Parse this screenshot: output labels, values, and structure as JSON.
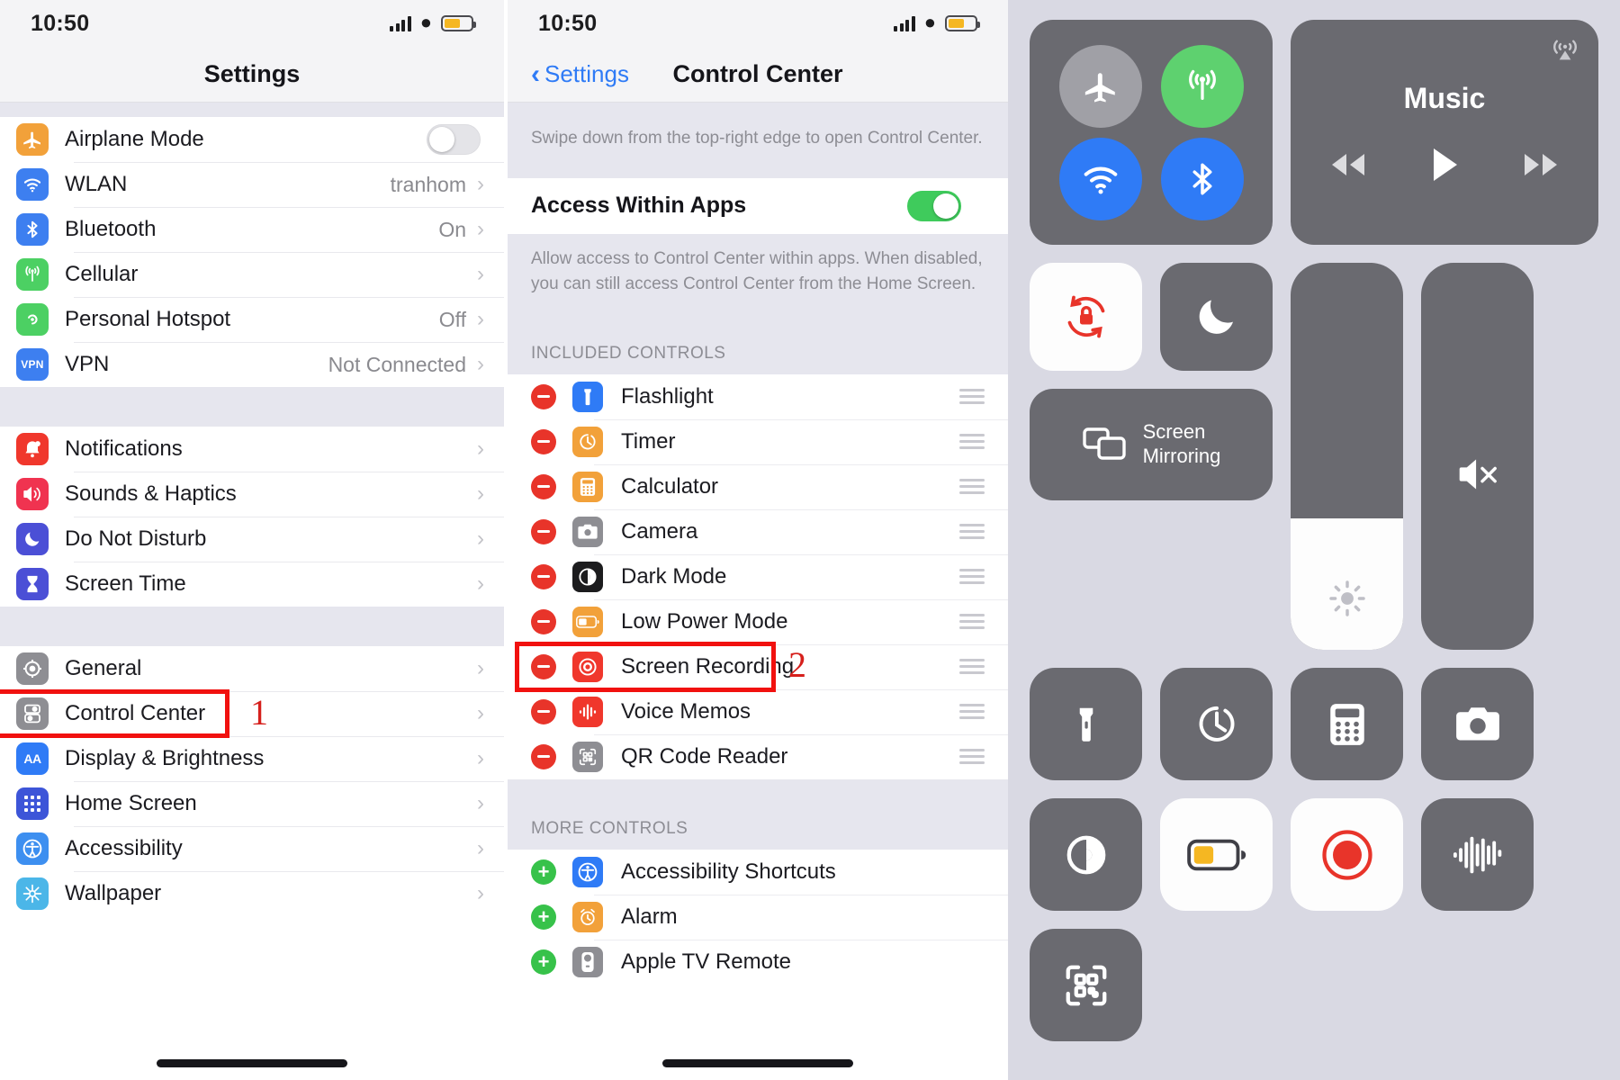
{
  "status_bar": {
    "time": "10:50",
    "battery_level_pct": 62
  },
  "panel_settings": {
    "nav_title": "Settings",
    "groups": [
      {
        "rows": [
          {
            "label": "Airplane Mode",
            "icon": "airplane-icon",
            "icon_bg": "#f2a13a",
            "accessory": "toggle",
            "toggle_on": false
          },
          {
            "label": "WLAN",
            "icon": "wifi-icon",
            "icon_bg": "#3d7ff0",
            "value": "tranhom",
            "accessory": "chevron"
          },
          {
            "label": "Bluetooth",
            "icon": "bluetooth-icon",
            "icon_bg": "#3d7ff0",
            "value": "On",
            "accessory": "chevron"
          },
          {
            "label": "Cellular",
            "icon": "cellular-icon",
            "icon_bg": "#4cd063",
            "value": "",
            "accessory": "chevron"
          },
          {
            "label": "Personal Hotspot",
            "icon": "hotspot-icon",
            "icon_bg": "#4cd063",
            "value": "Off",
            "accessory": "chevron"
          },
          {
            "label": "VPN",
            "icon": "vpn-icon",
            "icon_bg": "#3d7ff0",
            "value": "Not Connected",
            "accessory": "chevron"
          }
        ]
      },
      {
        "rows": [
          {
            "label": "Notifications",
            "icon": "notifications-icon",
            "icon_bg": "#f0372c",
            "value": "",
            "accessory": "chevron"
          },
          {
            "label": "Sounds & Haptics",
            "icon": "sounds-icon",
            "icon_bg": "#f03350",
            "value": "",
            "accessory": "chevron"
          },
          {
            "label": "Do Not Disturb",
            "icon": "moon-icon",
            "icon_bg": "#4b4fd6",
            "value": "",
            "accessory": "chevron"
          },
          {
            "label": "Screen Time",
            "icon": "hourglass-icon",
            "icon_bg": "#4b4fd6",
            "value": "",
            "accessory": "chevron"
          }
        ]
      },
      {
        "rows": [
          {
            "label": "General",
            "icon": "gear-icon",
            "icon_bg": "#8e8e93",
            "value": "",
            "accessory": "chevron"
          },
          {
            "label": "Control Center",
            "icon": "control-center-icon",
            "icon_bg": "#8e8e93",
            "value": "",
            "accessory": "chevron"
          },
          {
            "label": "Display & Brightness",
            "icon": "display-brightness-icon",
            "icon_bg": "#2f7bf6",
            "value": "",
            "accessory": "chevron"
          },
          {
            "label": "Home Screen",
            "icon": "home-screen-icon",
            "icon_bg": "#3d55d8",
            "value": "",
            "accessory": "chevron"
          },
          {
            "label": "Accessibility",
            "icon": "accessibility-icon",
            "icon_bg": "#3d8ff0",
            "value": "",
            "accessory": "chevron"
          },
          {
            "label": "Wallpaper",
            "icon": "wallpaper-icon",
            "icon_bg": "#4bb6e8",
            "value": "",
            "accessory": "chevron"
          }
        ]
      }
    ],
    "marker_label": "1",
    "highlight_target": "Control Center"
  },
  "panel_cc_settings": {
    "nav_back_label": "Settings",
    "nav_title": "Control Center",
    "hint_text": "Swipe down from the top-right edge to open Control Center.",
    "access_within_apps": {
      "label": "Access Within Apps",
      "enabled": true
    },
    "access_description": "Allow access to Control Center within apps. When disabled, you can still access Control Center from the Home Screen.",
    "included_header": "INCLUDED CONTROLS",
    "included_controls": [
      {
        "label": "Flashlight",
        "icon": "flashlight-icon",
        "icon_bg": "#2f7bf6",
        "action": "remove"
      },
      {
        "label": "Timer",
        "icon": "timer-icon",
        "icon_bg": "#f2a13a",
        "action": "remove"
      },
      {
        "label": "Calculator",
        "icon": "calculator-icon",
        "icon_bg": "#f2a13a",
        "action": "remove"
      },
      {
        "label": "Camera",
        "icon": "camera-icon",
        "icon_bg": "#8e8e93",
        "action": "remove"
      },
      {
        "label": "Dark Mode",
        "icon": "dark-mode-icon",
        "icon_bg": "#1c1c1e",
        "action": "remove"
      },
      {
        "label": "Low Power Mode",
        "icon": "low-power-mode-icon",
        "icon_bg": "#f2a13a",
        "action": "remove"
      },
      {
        "label": "Screen Recording",
        "icon": "screen-recording-icon",
        "icon_bg": "#f0372c",
        "action": "remove"
      },
      {
        "label": "Voice Memos",
        "icon": "voice-memos-icon",
        "icon_bg": "#f0372c",
        "action": "remove"
      },
      {
        "label": "QR Code Reader",
        "icon": "qr-code-icon",
        "icon_bg": "#8e8e93",
        "action": "remove"
      }
    ],
    "more_header": "MORE CONTROLS",
    "more_controls": [
      {
        "label": "Accessibility Shortcuts",
        "icon": "accessibility-icon",
        "icon_bg": "#2f7bf6",
        "action": "add"
      },
      {
        "label": "Alarm",
        "icon": "alarm-icon",
        "icon_bg": "#f2a13a",
        "action": "add"
      },
      {
        "label": "Apple TV Remote",
        "icon": "apple-tv-remote-icon",
        "icon_bg": "#8e8e93",
        "action": "add"
      }
    ],
    "marker_label": "2",
    "highlight_target": "Screen Recording"
  },
  "panel_control_center": {
    "connectivity": [
      {
        "name": "airplane-mode",
        "icon": "airplane-icon",
        "active": false,
        "color": "#a0a0a6"
      },
      {
        "name": "cellular-data",
        "icon": "cellular-icon",
        "active": true,
        "color": "#5ed16f"
      },
      {
        "name": "wifi",
        "icon": "wifi-icon",
        "active": true,
        "color": "#2f7bf6"
      },
      {
        "name": "bluetooth",
        "icon": "bluetooth-icon",
        "active": true,
        "color": "#2f7bf6"
      }
    ],
    "music": {
      "title": "Music",
      "prev_label": "rewind",
      "play_label": "play",
      "next_label": "fast-forward"
    },
    "rotation_lock": {
      "name": "rotation-lock",
      "active": true
    },
    "do_not_disturb": {
      "name": "do-not-disturb",
      "active": false
    },
    "screen_mirroring": {
      "line1": "Screen",
      "line2": "Mirroring"
    },
    "brightness": {
      "name": "brightness-slider",
      "value_pct": 34
    },
    "volume": {
      "name": "volume-slider",
      "value_pct": 0,
      "muted": true
    },
    "buttons": [
      {
        "name": "flashlight",
        "icon": "flashlight-icon",
        "active": false
      },
      {
        "name": "timer",
        "icon": "timer-icon",
        "active": false
      },
      {
        "name": "calculator",
        "icon": "calculator-icon",
        "active": false
      },
      {
        "name": "camera",
        "icon": "camera-icon",
        "active": false
      },
      {
        "name": "dark-mode",
        "icon": "dark-mode-icon",
        "active": false
      },
      {
        "name": "low-power-mode",
        "icon": "low-power-mode-icon",
        "active": true
      },
      {
        "name": "screen-recording",
        "icon": "screen-recording-icon",
        "active": true
      },
      {
        "name": "voice-memos",
        "icon": "voice-memos-icon",
        "active": false
      },
      {
        "name": "qr-code-reader",
        "icon": "qr-code-icon",
        "active": false
      }
    ]
  }
}
